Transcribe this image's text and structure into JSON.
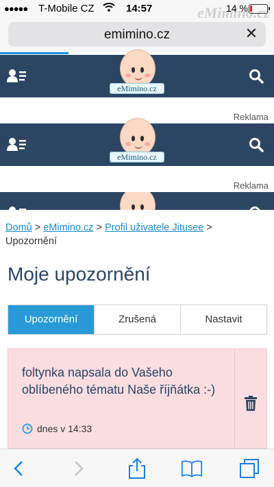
{
  "status_bar": {
    "carrier": "T-Mobile CZ",
    "time": "14:57",
    "watermark": "eMimino.cz",
    "battery_percent": "14 %",
    "battery_level": 0.14
  },
  "browser": {
    "url": "emimino.cz",
    "clear_glyph": "✕",
    "load_progress": 0.25
  },
  "site": {
    "logo_text": "eMimino.cz",
    "ad_label": "Reklama"
  },
  "breadcrumb": {
    "items": [
      "Domů",
      "eMimino.cz",
      "Profil uživatele Jitusee"
    ],
    "separator": " > ",
    "current": "Upozornění"
  },
  "page": {
    "title": "Moje upozornění"
  },
  "tabs": [
    {
      "label": "Upozornění",
      "active": true
    },
    {
      "label": "Zrušená",
      "active": false
    },
    {
      "label": "Nastavit",
      "active": false
    }
  ],
  "notification": {
    "text": "foltynka napsala do Vašeho oblíbeného tématu Naše říjňátka :-)",
    "time": "dnes v 14:33"
  },
  "colors": {
    "header_bg": "#2c4562",
    "accent": "#2a9ad7",
    "notice_bg": "#f9dde1",
    "link": "#1a86c9"
  },
  "icons": {
    "toolbar": [
      "back-icon",
      "forward-icon",
      "share-icon",
      "bookmarks-icon",
      "tabs-icon"
    ],
    "header": [
      "user-menu-icon",
      "search-icon"
    ]
  }
}
